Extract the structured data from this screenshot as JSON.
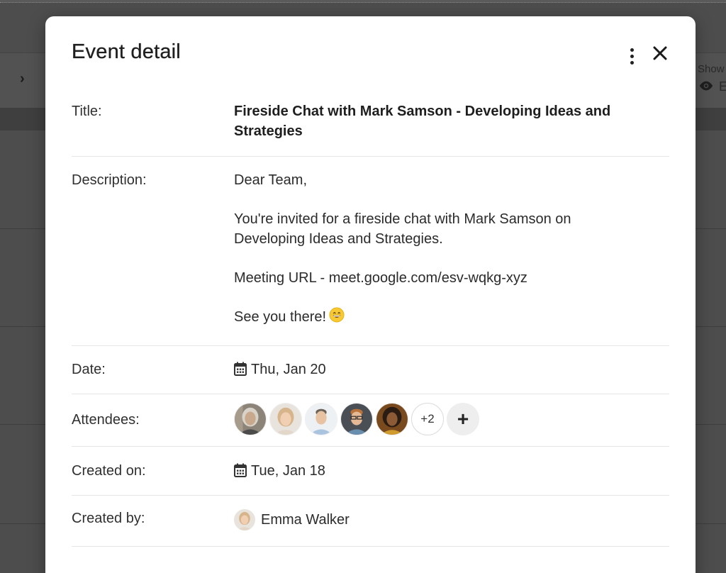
{
  "backdrop": {
    "show_label": "Show",
    "eye_text": "E"
  },
  "modal": {
    "title": "Event detail",
    "icons": {
      "menu": "more-vertical-icon",
      "close": "close-icon"
    }
  },
  "fields": {
    "title": {
      "label": "Title:",
      "value": "Fireside Chat with Mark Samson - Developing Ideas and Strategies"
    },
    "description": {
      "label": "Description:",
      "greeting": "Dear Team,",
      "body": "You're invited for a fireside chat with Mark Samson on Developing Ideas and Strategies.",
      "meeting": "Meeting URL - meet.google.com/esv-wqkg-xyz",
      "closing": "See you there!",
      "emoji": "grinning-face-icon"
    },
    "date": {
      "label": "Date:",
      "value": "Thu, Jan 20",
      "icon": "calendar-icon"
    },
    "attendees": {
      "label": "Attendees:",
      "more_count": "+2",
      "add_label": "+"
    },
    "created_on": {
      "label": "Created on:",
      "value": "Tue, Jan 18",
      "icon": "calendar-icon"
    },
    "created_by": {
      "label": "Created by:",
      "value": "Emma Walker"
    }
  },
  "colors": {
    "backdrop": "#4d4d4d",
    "modal_bg": "#ffffff",
    "separator": "#e6e6e6",
    "text": "#212121"
  }
}
